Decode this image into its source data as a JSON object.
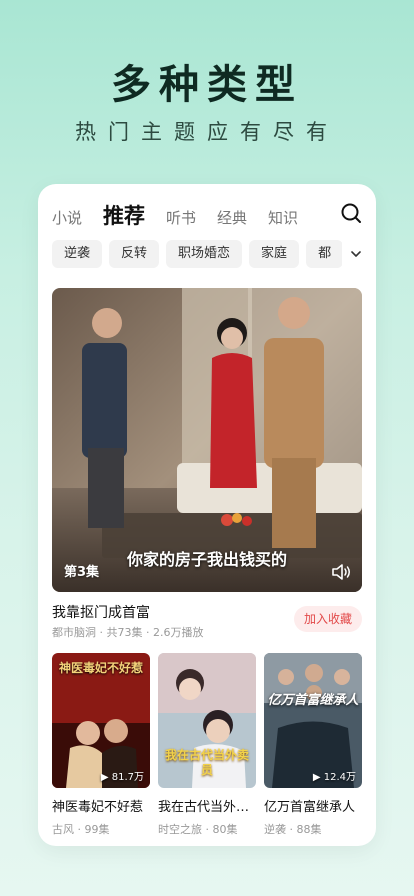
{
  "hero": {
    "title": "多种类型",
    "subtitle": "热门主题应有尽有"
  },
  "tabs": [
    {
      "label": "小说",
      "active": false
    },
    {
      "label": "推荐",
      "active": true
    },
    {
      "label": "听书",
      "active": false
    },
    {
      "label": "经典",
      "active": false
    },
    {
      "label": "知识",
      "active": false
    }
  ],
  "search_icon": "search-icon",
  "chips": [
    "逆袭",
    "反转",
    "职场婚恋",
    "家庭",
    "都"
  ],
  "chips_more_icon": "chevron-down-icon",
  "featured": {
    "episode": "第3集",
    "subtitle": "你家的房子我出钱买的",
    "title": "我靠抠门成首富",
    "meta": "都市脑洞 · 共73集 · 2.6万播放",
    "fav_label": "加入收藏",
    "volume_icon": "volume-icon"
  },
  "grid": [
    {
      "title": "神医毒妃不好惹",
      "meta": "古风 · 99集",
      "plays": "81.7万",
      "poster_text": "神医毒妃不好惹"
    },
    {
      "title": "我在古代当外…",
      "meta": "时空之旅 · 80集",
      "plays": "",
      "poster_text": "我在古代当外卖员"
    },
    {
      "title": "亿万首富继承人",
      "meta": "逆袭 · 88集",
      "plays": "12.4万",
      "poster_text": "亿万首富继承人"
    }
  ],
  "colors": {
    "accent_red": "#e24a4a",
    "fav_bg": "#fdecec",
    "bg_top": "#a9e6d3"
  }
}
